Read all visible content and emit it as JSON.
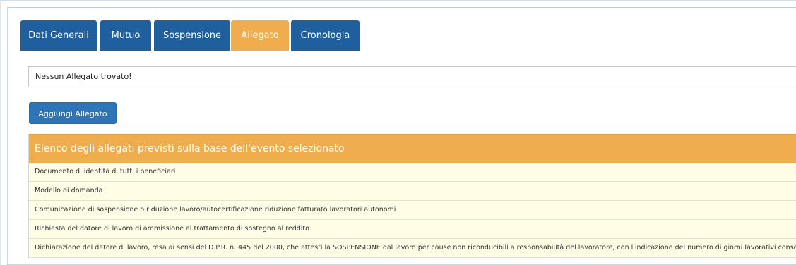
{
  "tabs": [
    {
      "label": "Dati Generali",
      "active": false
    },
    {
      "label": "Mutuo",
      "active": false
    },
    {
      "label": "Sospensione",
      "active": false
    },
    {
      "label": "Allegato",
      "active": true
    },
    {
      "label": "Cronologia",
      "active": false
    }
  ],
  "allegato": {
    "message": "Nessun Allegato trovato!",
    "add_button_label": "Aggiungi Allegato"
  },
  "expected_attachments": {
    "header": "Elenco degli allegati previsti sulla base dell'evento selezionato",
    "items": [
      "Documento di identità di tutti i beneficiari",
      "Modello di domanda",
      "Comunicazione di sospensione o riduzione lavoro/autocertificazione riduzione fatturato lavoratori autonomi",
      "Richiesta del datore di lavoro di ammissione al trattamento di sostegno al reddito",
      "Dichiarazione del datore di lavoro, resa ai sensi del D.P.R. n. 445 del 2000, che attesti la SOSPENSIONE dal lavoro per cause non riconducibili a responsabilità del lavoratore, con l'indicazione del numero di giorni lavorativi consecutivi"
    ]
  },
  "colors": {
    "tab_default": "#1f5f9d",
    "tab_active": "#f0ad4e",
    "button": "#2f75b5",
    "list_header": "#f0ad4e",
    "list_row": "#fffde5"
  }
}
